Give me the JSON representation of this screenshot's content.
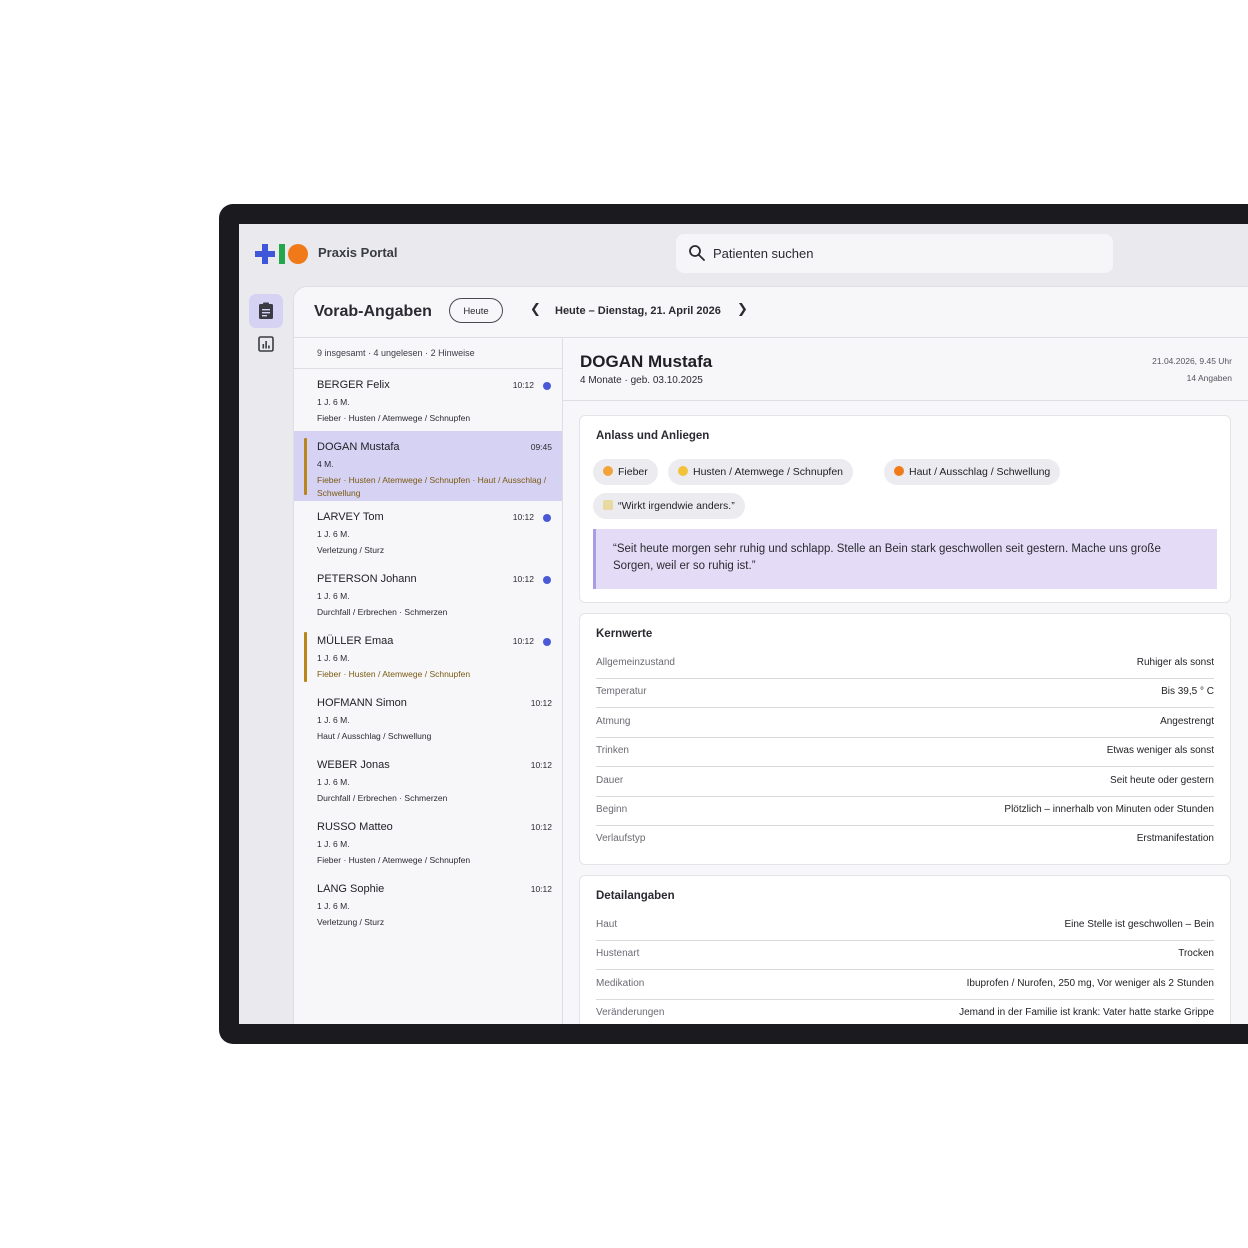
{
  "app": {
    "title": "Praxis Portal"
  },
  "search": {
    "placeholder": "Patienten suchen"
  },
  "header": {
    "title": "Vorab-Angaben",
    "today_button": "Heute",
    "date": "Heute – Dienstag, 21. April 2026",
    "prev_icon": "chevron-left-icon",
    "next_icon": "chevron-right-icon"
  },
  "rail": {
    "items": [
      {
        "icon": "clipboard-icon",
        "active": true
      },
      {
        "icon": "chart-icon",
        "active": false
      }
    ]
  },
  "list": {
    "summary": "9 insgesamt · 4 ungelesen · 2 Hinweise",
    "items": [
      {
        "name": "BERGER Felix",
        "age": "1 J. 6 M.",
        "category": "Fieber · Husten / Atemwege / Schnupfen",
        "time": "10:12",
        "unread": true,
        "flag": false,
        "selected": false
      },
      {
        "name": "DOGAN Mustafa",
        "age": "4 M.",
        "category": "Fieber · Husten / Atemwege / Schnupfen · Haut / Ausschlag / Schwellung",
        "time": "09:45",
        "unread": false,
        "flag": true,
        "selected": true
      },
      {
        "name": "LARVEY Tom",
        "age": "1 J. 6 M.",
        "category": "Verletzung / Sturz",
        "time": "10:12",
        "unread": true,
        "flag": false,
        "selected": false
      },
      {
        "name": "PETERSON Johann",
        "age": "1 J. 6 M.",
        "category": "Durchfall / Erbrechen · Schmerzen",
        "time": "10:12",
        "unread": true,
        "flag": false,
        "selected": false
      },
      {
        "name": "MÜLLER Emaa",
        "age": "1 J. 6 M.",
        "category": "Fieber · Husten / Atemwege / Schnupfen",
        "time": "10:12",
        "unread": true,
        "flag": true,
        "selected": false
      },
      {
        "name": "HOFMANN Simon",
        "age": "1 J. 6 M.",
        "category": "Haut / Ausschlag / Schwellung",
        "time": "10:12",
        "unread": false,
        "flag": false,
        "selected": false
      },
      {
        "name": "WEBER Jonas",
        "age": "1 J. 6 M.",
        "category": "Durchfall / Erbrechen · Schmerzen",
        "time": "10:12",
        "unread": false,
        "flag": false,
        "selected": false
      },
      {
        "name": "RUSSO Matteo",
        "age": "1 J. 6 M.",
        "category": "Fieber · Husten / Atemwege / Schnupfen",
        "time": "10:12",
        "unread": false,
        "flag": false,
        "selected": false
      },
      {
        "name": "LANG Sophie",
        "age": "1 J. 6 M.",
        "category": "Verletzung / Sturz",
        "time": "10:12",
        "unread": false,
        "flag": false,
        "selected": false
      }
    ]
  },
  "patient": {
    "name": "DOGAN Mustafa",
    "subtitle": "4 Monate · geb. 03.10.2025",
    "submitted": "21.04.2026, 9.45 Uhr",
    "count": "14 Angaben"
  },
  "anlass": {
    "title": "Anlass und Anliegen",
    "chips": [
      {
        "label": "Fieber",
        "icon": "hot-face-emoji",
        "color": "#f2a33a"
      },
      {
        "label": "Husten / Atemwege / Schnupfen",
        "icon": "sneezing-face-emoji",
        "color": "#f2c23a"
      },
      {
        "label": "Haut / Ausschlag / Schwellung",
        "icon": "orange-circle-emoji",
        "color": "#f07a1a"
      },
      {
        "label": "“Wirkt irgendwie anders.”",
        "icon": "note-emoji",
        "color": "#e8d9a0"
      }
    ],
    "quote": "“Seit heute morgen sehr ruhig und schlapp. Stelle an Bein stark geschwollen seit gestern. Mache uns große Sorgen, weil er so ruhig ist.”"
  },
  "kernwerte": {
    "title": "Kernwerte",
    "rows": [
      {
        "label": "Allgemeinzustand",
        "value": "Ruhiger als sonst"
      },
      {
        "label": "Temperatur",
        "value": "Bis 39,5 ° C"
      },
      {
        "label": "Atmung",
        "value": "Angestrengt"
      },
      {
        "label": "Trinken",
        "value": "Etwas weniger als sonst"
      },
      {
        "label": "Dauer",
        "value": "Seit heute oder gestern"
      },
      {
        "label": "Beginn",
        "value": "Plötzlich – innerhalb von Minuten oder Stunden"
      },
      {
        "label": "Verlaufstyp",
        "value": "Erstmanifestation"
      }
    ]
  },
  "detailangaben": {
    "title": "Detailangaben",
    "rows": [
      {
        "label": "Haut",
        "value": "Eine Stelle ist geschwollen – Bein"
      },
      {
        "label": "Hustenart",
        "value": "Trocken"
      },
      {
        "label": "Medikation",
        "value": "Ibuprofen / Nurofen, 250 mg, Vor weniger als 2 Stunden"
      },
      {
        "label": "Veränderungen",
        "value": "Jemand in der Familie ist krank: Vater hatte starke Grippe"
      }
    ]
  },
  "colors": {
    "accent": "#d6d2f4",
    "unread_dot": "#4a5ad6",
    "flag": "#b8861b",
    "quote_bg": "#e4dcf7"
  }
}
